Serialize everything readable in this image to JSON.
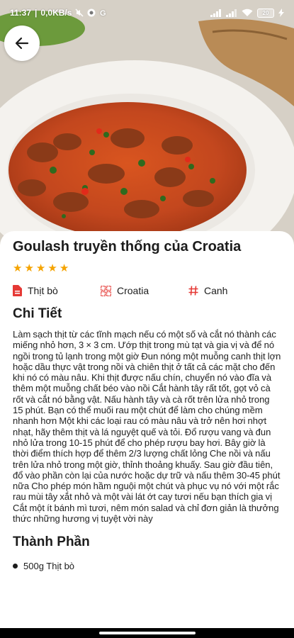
{
  "status_bar": {
    "time": "11:37",
    "network_speed": "0,0KB/s",
    "battery_level": "20"
  },
  "recipe": {
    "title": "Goulash truyền thống của Croatia",
    "rating": 5,
    "tags": [
      {
        "icon": "file-icon",
        "label": "Thịt bò"
      },
      {
        "icon": "grid-icon",
        "label": "Croatia"
      },
      {
        "icon": "hashtag-icon",
        "label": "Canh"
      }
    ],
    "details_heading": "Chi Tiết",
    "description": "Làm sạch thịt từ các tĩnh mạch nếu có một số và cắt nó thành các miếng nhỏ hơn, 3 × 3 cm. Ướp thịt trong mù tạt và gia vị và để nó ngồi trong tủ lạnh trong một giờ Đun nóng một muỗng canh thịt lợn hoặc dầu thực vật trong nồi và chiên thịt ở tất cả các mặt cho đến khi nó có màu nâu. Khi thịt được nấu chín, chuyển nó vào đĩa và thêm một muỗng chất béo vào nồi Cắt hành tây rất tốt, gọt vỏ cà rốt và cắt nó bằng vật. Nấu hành tây và cà rốt trên lửa nhỏ trong 15 phút. Bạn có thể muối rau một chút để làm cho chúng mềm nhanh hơn Một khi các loại rau có màu nâu và trở nên hơi nhợt nhạt, hãy thêm thịt và lá nguyệt quế và tỏi. Đổ rượu vang và đun nhỏ lửa trong 10-15 phút để cho phép rượu bay hơi. Bây giờ là thời điểm thích hợp để thêm 2/3 lượng chất lỏng Che nồi và nấu trên lửa nhỏ trong một giờ, thỉnh thoảng khuấy. Sau giờ đầu tiên, đổ vào phần còn lại của nước hoặc dự trữ và nấu thêm 30-45 phút nữa Cho phép món hầm nguội một chút và phục vụ nó với một rắc rau mùi tây xắt nhỏ và một vài lát ớt cay tươi nếu bạn thích gia vị Cắt một ít bánh mì tươi, nêm món salad và chỉ đơn giản là thưởng thức những hương vị tuyệt vời này",
    "ingredients_heading": "Thành Phần",
    "ingredients": [
      "500g Thịt bò"
    ]
  },
  "colors": {
    "star": "#f5a300",
    "tag_icon_red": "#e53935",
    "soup": "#c3471e"
  }
}
